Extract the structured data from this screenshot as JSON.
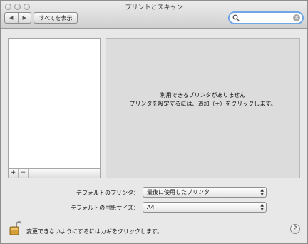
{
  "window": {
    "title": "プリントとスキャン"
  },
  "toolbar": {
    "back_glyph": "◀",
    "forward_glyph": "▶",
    "show_all_label": "すべてを表示",
    "search": {
      "value": "",
      "placeholder": "",
      "clear_glyph": "✕"
    }
  },
  "printer_list": {
    "items": [],
    "add_label": "+",
    "remove_label": "−"
  },
  "detail": {
    "empty_line1": "利用できるプリンタがありません",
    "empty_line2": "プリンタを設定するには、追加（+）をクリックします。"
  },
  "defaults": {
    "printer_label": "デフォルトのプリンタ：",
    "printer_value": "最後に使用したプリンタ",
    "paper_label": "デフォルトの用紙サイズ：",
    "paper_value": "A4",
    "arrows_glyph": "▲▼"
  },
  "footer": {
    "lock_text": "変更できないようにするにはカギをクリックします。",
    "help_label": "?"
  },
  "colors": {
    "focus_ring": "#6ea6e6",
    "window_bg": "#e8e8e8",
    "pane_bg": "#dcdcdc"
  }
}
